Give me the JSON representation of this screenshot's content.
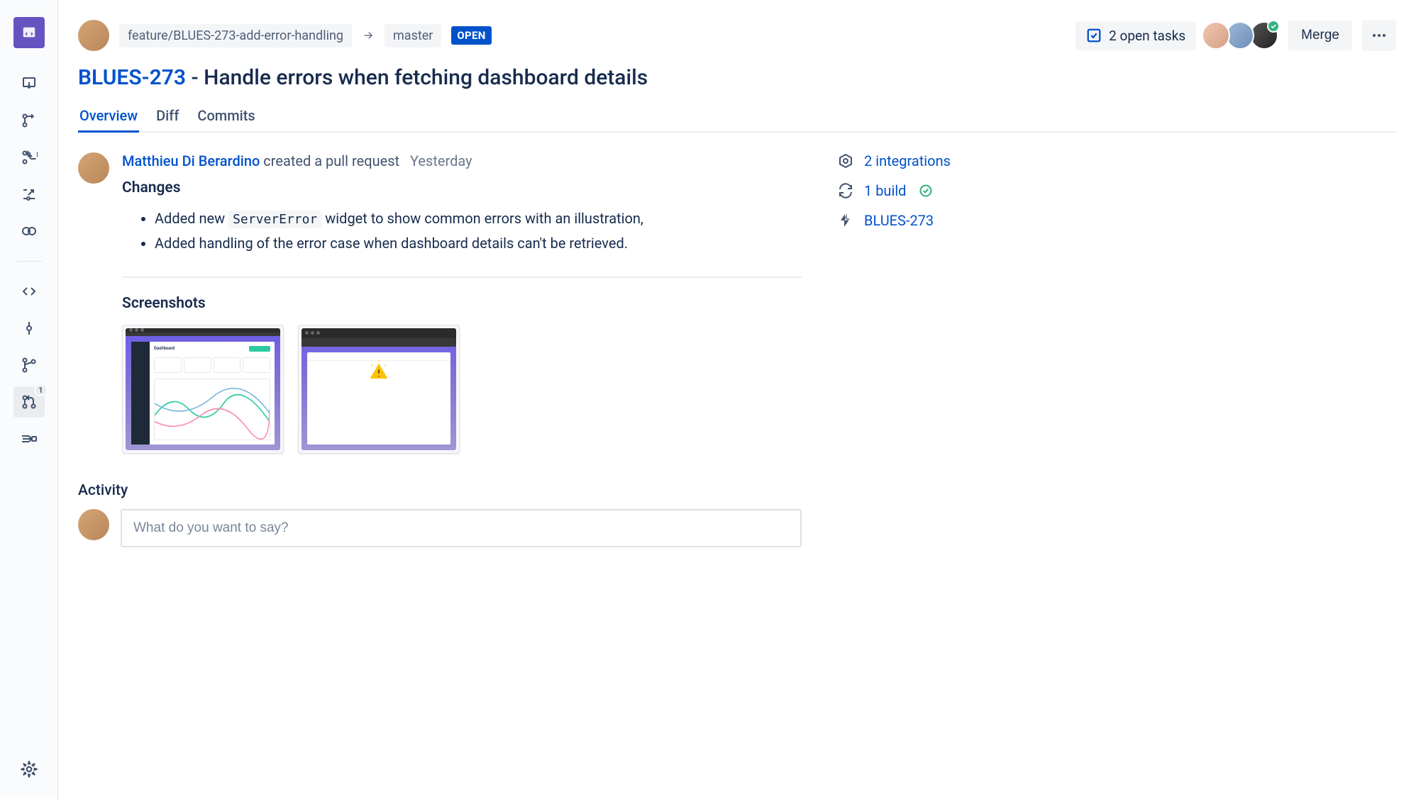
{
  "header": {
    "sourceBranch": "feature/BLUES-273-add-error-handling",
    "targetBranch": "master",
    "statusLabel": "OPEN",
    "openTasksLabel": "2 open tasks",
    "mergeLabel": "Merge",
    "prBadgeCount": "1"
  },
  "title": {
    "key": "BLUES-273",
    "separator": " - ",
    "rest": "Handle errors when fetching dashboard details"
  },
  "tabs": {
    "overview": "Overview",
    "diff": "Diff",
    "commits": "Commits"
  },
  "pr": {
    "author": "Matthieu Di Berardino",
    "action": "created a pull request",
    "time": "Yesterday",
    "changesTitle": "Changes",
    "change1_pre": "Added new ",
    "change1_code": "ServerError",
    "change1_post": " widget to show common errors with an illustration,",
    "change2": "Added handling of the error case when dashboard details can't be retrieved.",
    "screenshotsTitle": "Screenshots"
  },
  "sidePanel": {
    "integrations": "2 integrations",
    "builds": "1 build",
    "jiraKey": "BLUES-273"
  },
  "activity": {
    "title": "Activity",
    "placeholder": "What do you want to say?"
  }
}
